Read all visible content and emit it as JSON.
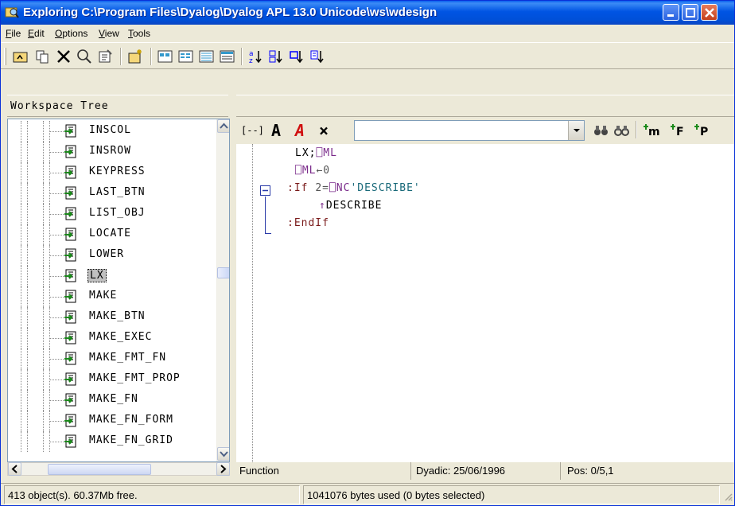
{
  "window": {
    "title": "Exploring C:\\Program Files\\Dyalog\\Dyalog APL 13.0 Unicode\\ws\\wdesign"
  },
  "menu": [
    {
      "label": "File",
      "hot": "F"
    },
    {
      "label": "Edit",
      "hot": "E"
    },
    {
      "label": "Options",
      "hot": "O"
    },
    {
      "label": "View",
      "hot": "V"
    },
    {
      "label": "Tools",
      "hot": "T"
    }
  ],
  "toolbar": {
    "icons": [
      "up-folder-icon",
      "copy-icon",
      "delete-icon",
      "find-icon",
      "properties-icon",
      "new-icon",
      "large-icons-view-icon",
      "small-icons-view-icon",
      "list-view-icon",
      "details-view-icon",
      "sort-by-name-icon",
      "sort-by-type-icon",
      "sort-by-size-icon",
      "sort-by-date-icon"
    ]
  },
  "left_pane": {
    "header": "Workspace Tree",
    "items": [
      "INSCOL",
      "INSROW",
      "KEYPRESS",
      "LAST_BTN",
      "LIST_OBJ",
      "LOCATE",
      "LOWER",
      "LX",
      "MAKE",
      "MAKE_BTN",
      "MAKE_EXEC",
      "MAKE_FMT_FN",
      "MAKE_FMT_PROP",
      "MAKE_FN",
      "MAKE_FN_FORM",
      "MAKE_FN_GRID"
    ],
    "selected": "LX"
  },
  "editor": {
    "toolbar_buttons": [
      "[--]",
      "A",
      "A",
      "×"
    ],
    "search_value": "",
    "search_icons": [
      "find-icon",
      "find-next-icon",
      "insert-monadic-icon",
      "insert-function-icon",
      "insert-property-icon"
    ],
    "lines": [
      {
        "indent": 0,
        "parts": [
          {
            "t": "LX;",
            "c": ""
          },
          {
            "t": "⎕ML",
            "c": "sys"
          }
        ]
      },
      {
        "indent": 0,
        "parts": [
          {
            "t": "⎕ML",
            "c": "sys"
          },
          {
            "t": "←0",
            "c": "num"
          }
        ]
      },
      {
        "indent": 0,
        "parts": [
          {
            "t": ":If ",
            "c": "kw"
          },
          {
            "t": "2=",
            "c": "num"
          },
          {
            "t": "⎕NC",
            "c": "sys"
          },
          {
            "t": "'DESCRIBE'",
            "c": "str"
          }
        ]
      },
      {
        "indent": 1,
        "parts": [
          {
            "t": "↑",
            "c": "sys"
          },
          {
            "t": "DESCRIBE",
            "c": ""
          }
        ]
      },
      {
        "indent": 0,
        "parts": [
          {
            "t": ":EndIf",
            "c": "kw"
          }
        ]
      }
    ]
  },
  "editor_status": {
    "type": "Function",
    "dyadic": "Dyadic: 25/06/1996",
    "pos": "Pos: 0/5,1"
  },
  "status": {
    "objects": "413 object(s). 60.37Mb free.",
    "bytes": "1041076 bytes used (0 bytes selected)"
  }
}
